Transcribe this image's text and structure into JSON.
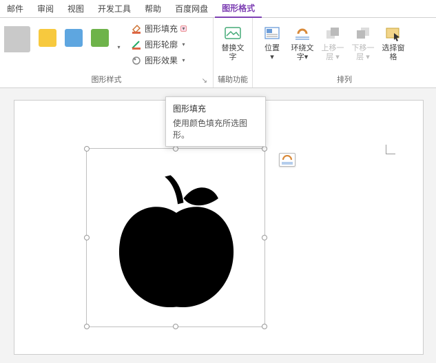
{
  "menu": {
    "mail": "邮件",
    "review": "审阅",
    "view": "视图",
    "dev": "开发工具",
    "help": "帮助",
    "netdisk": "百度网盘",
    "shapefmt": "图形格式"
  },
  "ribbon": {
    "styles_label": "图形样式",
    "fill": "图形填充",
    "outline": "图形轮廓",
    "effects": "图形效果",
    "alt_text": "替换文字",
    "accessibility_label": "辅助功能",
    "position": "位置",
    "wrap": "环绕文字",
    "bring_forward": "上移一层",
    "send_backward": "下移一层",
    "selection_pane": "选择窗格",
    "arrange_label": "排列"
  },
  "swatches": {
    "gray": "#c9c9c9",
    "yellow": "#f7c93e",
    "blue": "#5ea6e0",
    "green": "#6eb34a"
  },
  "tooltip": {
    "title": "图形填充",
    "body": "使用颜色填充所选图形。"
  },
  "dropdown_glyph": "▾"
}
